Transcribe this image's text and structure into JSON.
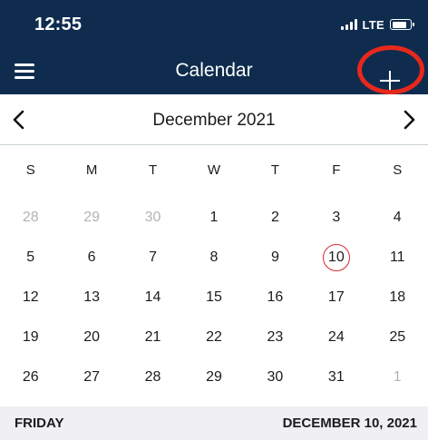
{
  "status_bar": {
    "time": "12:55",
    "network": "LTE",
    "battery_level": 0.85
  },
  "nav": {
    "title": "Calendar",
    "add_label": "+"
  },
  "calendar": {
    "month_title": "December 2021",
    "weekdays": [
      "S",
      "M",
      "T",
      "W",
      "T",
      "F",
      "S"
    ],
    "weeks": [
      [
        {
          "d": "28",
          "m": true
        },
        {
          "d": "29",
          "m": true
        },
        {
          "d": "30",
          "m": true
        },
        {
          "d": "1"
        },
        {
          "d": "2"
        },
        {
          "d": "3"
        },
        {
          "d": "4"
        }
      ],
      [
        {
          "d": "5"
        },
        {
          "d": "6"
        },
        {
          "d": "7"
        },
        {
          "d": "8"
        },
        {
          "d": "9"
        },
        {
          "d": "10",
          "sel": true
        },
        {
          "d": "11"
        }
      ],
      [
        {
          "d": "12"
        },
        {
          "d": "13"
        },
        {
          "d": "14"
        },
        {
          "d": "15"
        },
        {
          "d": "16"
        },
        {
          "d": "17"
        },
        {
          "d": "18"
        }
      ],
      [
        {
          "d": "19"
        },
        {
          "d": "20"
        },
        {
          "d": "21"
        },
        {
          "d": "22"
        },
        {
          "d": "23"
        },
        {
          "d": "24"
        },
        {
          "d": "25"
        }
      ],
      [
        {
          "d": "26"
        },
        {
          "d": "27"
        },
        {
          "d": "28"
        },
        {
          "d": "29"
        },
        {
          "d": "30"
        },
        {
          "d": "31"
        },
        {
          "d": "1",
          "m": true
        }
      ]
    ],
    "selected_color": "#d6282e"
  },
  "footer": {
    "day_label": "FRIDAY",
    "date_label": "DECEMBER 10, 2021"
  },
  "colors": {
    "header_bg": "#0f2c4e",
    "highlight_ring": "#e8281c",
    "footer_bg": "#efeff4",
    "muted_text": "#b3b3b3"
  },
  "icons": {
    "menu": "hamburger-icon",
    "add": "plus-icon",
    "prev": "chevron-left-icon",
    "next": "chevron-right-icon"
  }
}
